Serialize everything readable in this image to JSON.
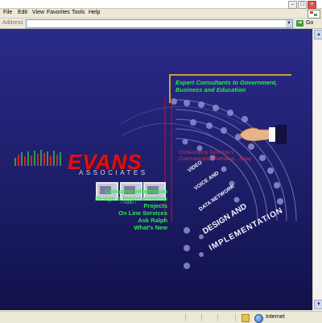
{
  "browser": {
    "menu": [
      "File",
      "Edit",
      "View",
      "Favorites",
      "Tools",
      "Help"
    ],
    "address_label": "Address",
    "address_value": "",
    "go_label": "Go",
    "status_zone": "Internet"
  },
  "page": {
    "tagline": [
      "Expert Consultants to Government,",
      "Business and Education"
    ],
    "logo_word": "EVANS",
    "logo_sub": "ASSOCIATES",
    "slogan": [
      "Orchestrating Tomorrow's",
      "Communication Pathways...Today"
    ],
    "video_label": "• Video •",
    "nav": [
      "Company Information",
      "Design & Implementation",
      "Projects",
      "On Line Services",
      "Ask Ralph",
      "What's New"
    ],
    "arcs": [
      "VIDEO",
      "VOICE AND",
      "DATA NETWORK",
      "DESIGN AND",
      "IMPLEMENTATION"
    ]
  }
}
